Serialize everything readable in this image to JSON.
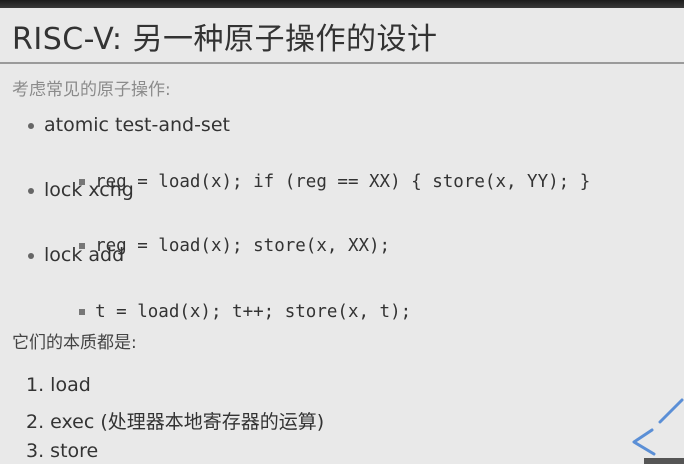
{
  "slide": {
    "title": "RISC-V: 另一种原子操作的设计",
    "intro": "考虑常见的原子操作:",
    "items": [
      {
        "label": "atomic test-and-set",
        "code": "reg = load(x); if (reg == XX) { store(x, YY); }"
      },
      {
        "label": "lock xchg",
        "code": "reg = load(x); store(x, XX);"
      },
      {
        "label": "lock add",
        "code": "t = load(x); t++; store(x, t);"
      }
    ],
    "essence_heading": "它们的本质都是:",
    "steps": [
      "1. load",
      "2. exec (处理器本地寄存器的运算)",
      "3. store"
    ]
  },
  "colors": {
    "background": "#e9e9e9",
    "accent": "#5b8fd6"
  }
}
